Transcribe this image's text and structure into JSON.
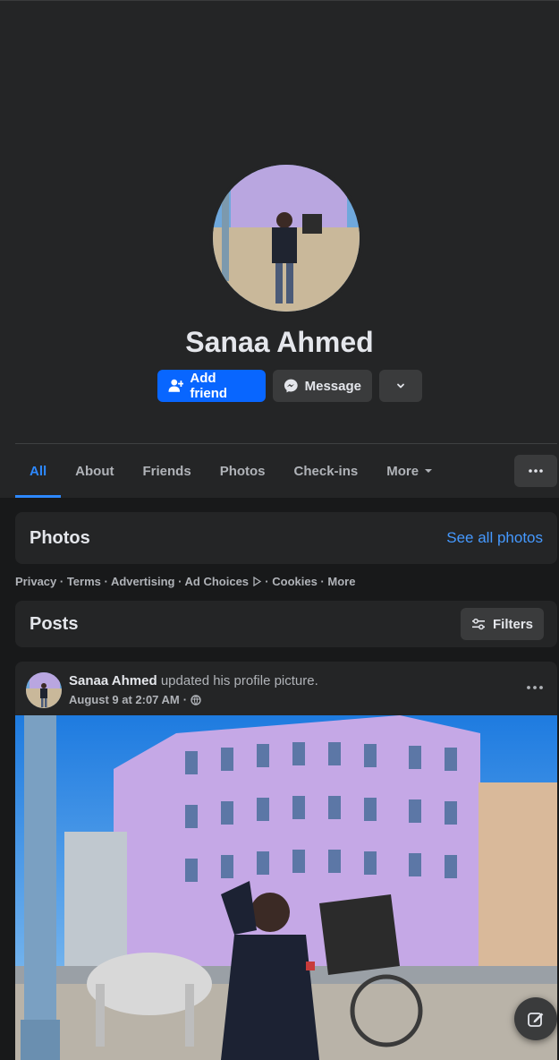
{
  "profile": {
    "name": "Sanaa Ahmed"
  },
  "actions": {
    "add_friend": "Add friend",
    "message": "Message"
  },
  "tabs": [
    {
      "label": "All",
      "active": true
    },
    {
      "label": "About"
    },
    {
      "label": "Friends"
    },
    {
      "label": "Photos"
    },
    {
      "label": "Check-ins"
    },
    {
      "label": "More"
    }
  ],
  "photos_section": {
    "title": "Photos",
    "see_all": "See all photos"
  },
  "footer": {
    "links": "Privacy · Terms · Advertising · Ad Choices",
    "links2": "· Cookies · More"
  },
  "posts_section": {
    "title": "Posts",
    "filters": "Filters"
  },
  "post": {
    "author": "Sanaa Ahmed",
    "action": "updated his profile picture.",
    "timestamp": "August 9 at 2:07 AM",
    "separator": "·",
    "audience_icon": "globe-icon"
  },
  "colors": {
    "background": "#18191a",
    "card": "#242526",
    "button": "#3a3b3c",
    "primary": "#0866ff",
    "link": "#4599ff",
    "text": "#e4e6eb",
    "secondary_text": "#b0b3b8"
  }
}
